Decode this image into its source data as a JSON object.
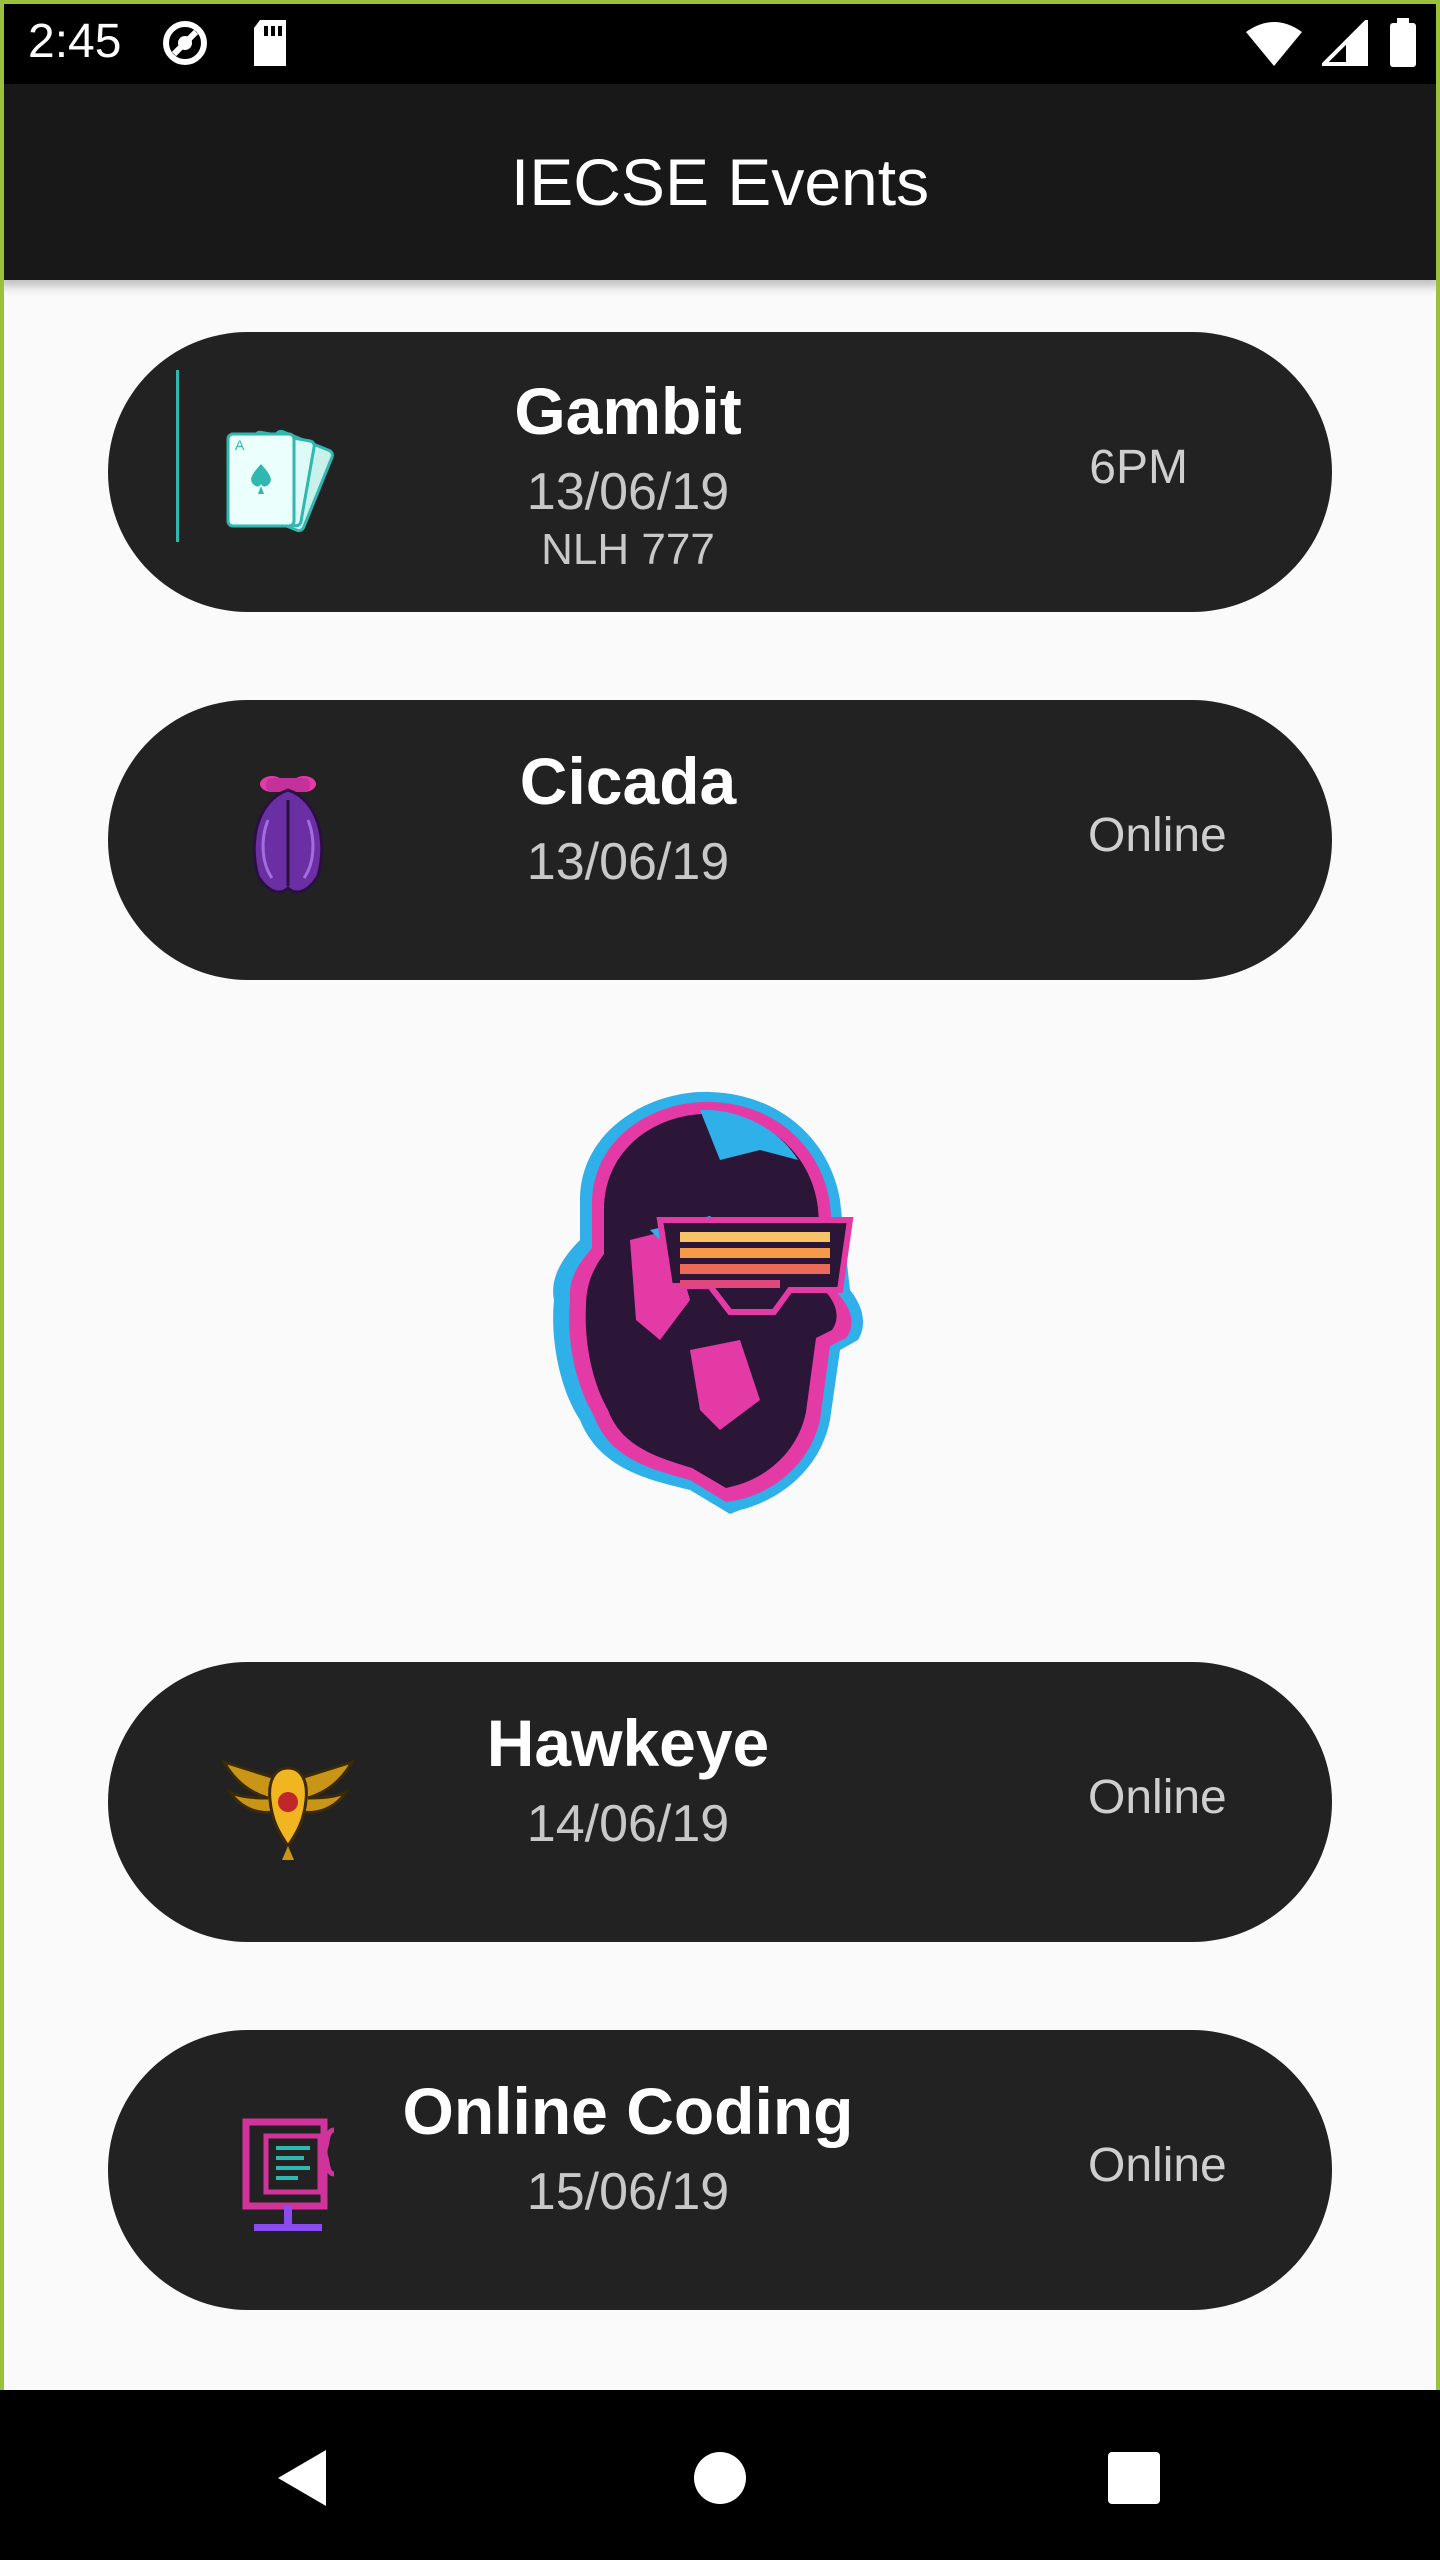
{
  "status_bar": {
    "time": "2:45"
  },
  "app_bar": {
    "title": "IECSE Events"
  },
  "events": [
    {
      "title": "Gambit",
      "date": "13/06/19",
      "venue": "NLH 777",
      "time": "6PM"
    },
    {
      "title": "Cicada",
      "date": "13/06/19",
      "mode": "Online"
    },
    {
      "title": "Hawkeye",
      "date": "14/06/19",
      "mode": "Online"
    },
    {
      "title": "Online Coding",
      "date": "15/06/19",
      "mode": "Online"
    }
  ],
  "icons": {
    "status_left": [
      "sync-disabled-icon",
      "sd-card-icon"
    ],
    "status_right": [
      "wifi-icon",
      "cellular-signal-icon",
      "battery-icon"
    ],
    "events": [
      "playing-cards-icon",
      "cicada-icon",
      "hawk-icon",
      "coding-monitor-icon"
    ],
    "nav": [
      "back-icon",
      "home-icon",
      "recents-icon"
    ]
  },
  "colors": {
    "status_bar": "#000000",
    "app_bar": "#181818",
    "background": "#fafafa",
    "card": "#222222",
    "card_text": "#ffffff",
    "card_secondary_text": "#c8c8c8",
    "frame_border": "#9bc13a",
    "accent_teal": "#2fb7b0"
  }
}
